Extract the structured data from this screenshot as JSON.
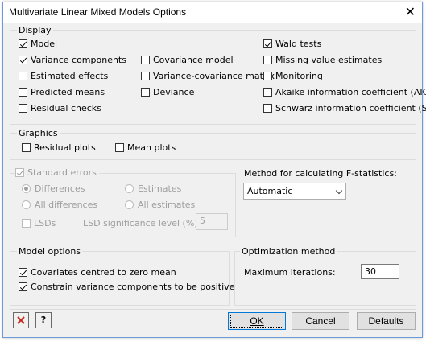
{
  "window": {
    "title": "Multivariate Linear Mixed Models Options",
    "close_glyph": "✕"
  },
  "display": {
    "label": "Display",
    "col1": [
      {
        "label": "Model",
        "checked": true
      },
      {
        "label": "Variance components",
        "checked": true
      },
      {
        "label": "Estimated effects",
        "checked": false
      },
      {
        "label": "Predicted means",
        "checked": false
      },
      {
        "label": "Residual checks",
        "checked": false
      }
    ],
    "col2": [
      {
        "label": "Covariance model",
        "checked": false
      },
      {
        "label": "Variance-covariance matrix",
        "checked": false
      },
      {
        "label": "Deviance",
        "checked": false
      }
    ],
    "col3": [
      {
        "label": "Wald tests",
        "checked": true
      },
      {
        "label": "Missing value estimates",
        "checked": false
      },
      {
        "label": "Monitoring",
        "checked": false
      },
      {
        "label": "Akaike information coefficient (AIC)",
        "checked": false
      },
      {
        "label": "Schwarz information coefficient (SIC)",
        "checked": false
      }
    ]
  },
  "graphics": {
    "label": "Graphics",
    "items": [
      {
        "label": "Residual plots",
        "checked": false
      },
      {
        "label": "Mean plots",
        "checked": false
      }
    ]
  },
  "standard_errors": {
    "label": "Standard errors",
    "checked": true,
    "enabled": false,
    "radios": [
      {
        "label": "Differences",
        "selected": true
      },
      {
        "label": "Estimates",
        "selected": false
      },
      {
        "label": "All differences",
        "selected": false
      },
      {
        "label": "All estimates",
        "selected": false
      }
    ],
    "lsds_label": "LSDs",
    "lsd_level_label": "LSD significance level (%):",
    "lsd_level_value": "5"
  },
  "fstat": {
    "label": "Method for calculating F-statistics:",
    "selected": "Automatic"
  },
  "model_options": {
    "label": "Model options",
    "items": [
      {
        "label": "Covariates centred to zero mean",
        "checked": true
      },
      {
        "label": "Constrain variance components to be positive",
        "checked": true
      }
    ]
  },
  "optimization": {
    "label": "Optimization method",
    "max_iter_label": "Maximum iterations:",
    "max_iter_value": "30"
  },
  "buttons": {
    "ok": "OK",
    "cancel": "Cancel",
    "defaults": "Defaults",
    "clear_icon": "close-icon",
    "help_icon": "help-icon",
    "help_glyph": "?"
  },
  "colors": {
    "clear_icon_red": "#c42b1c",
    "focus_blue": "#0078d7"
  }
}
